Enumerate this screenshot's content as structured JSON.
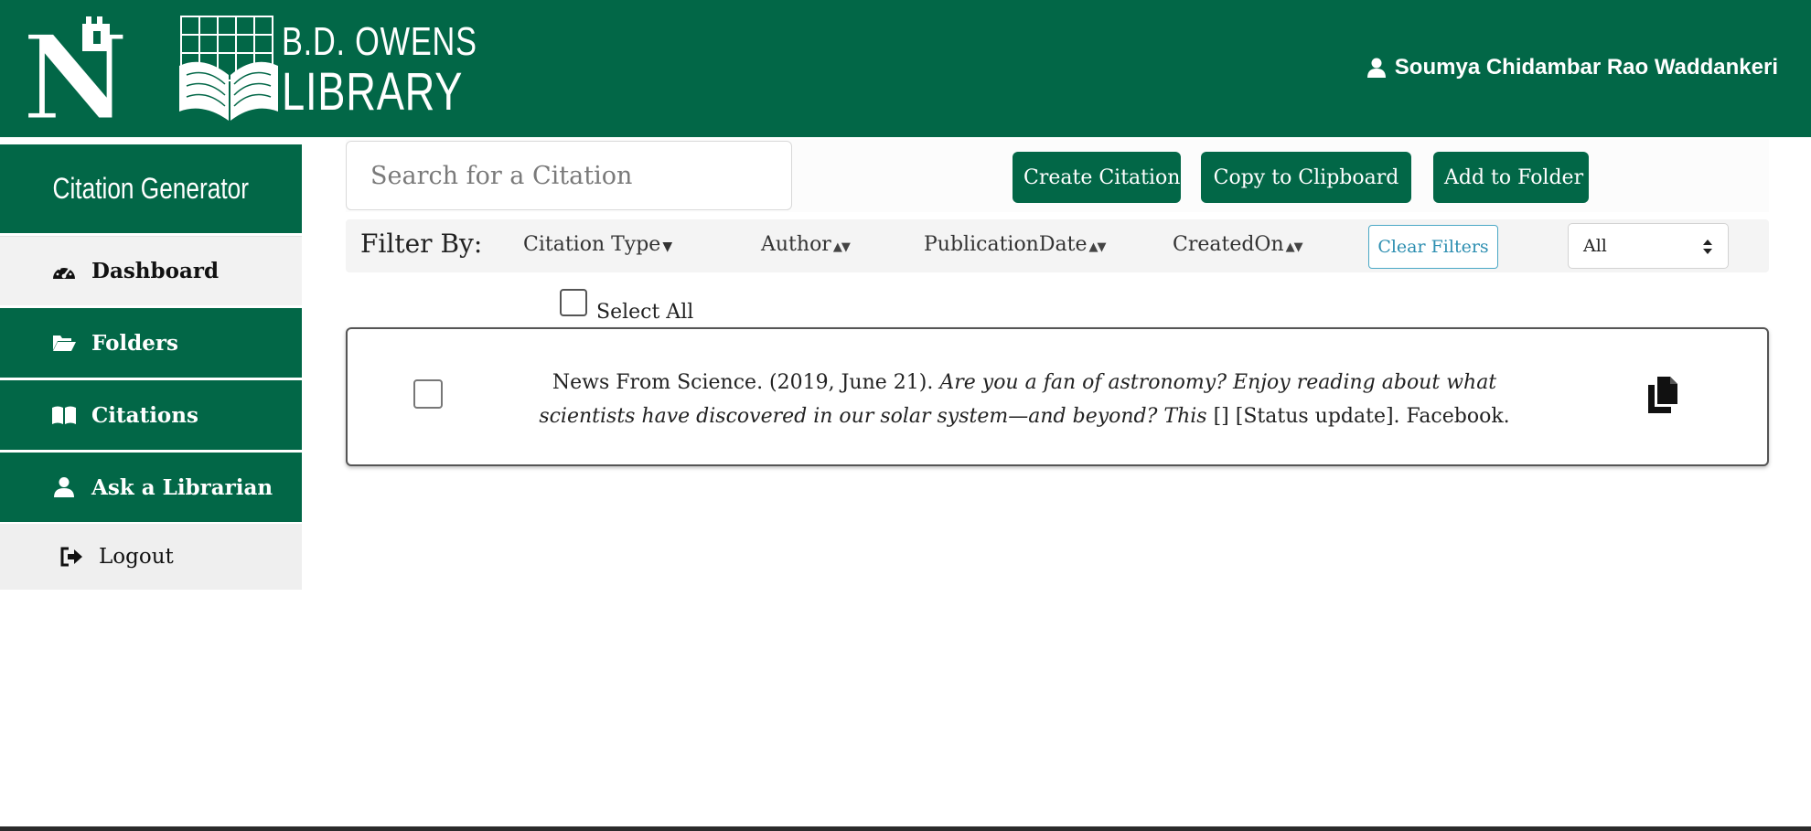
{
  "header": {
    "logo_initial": "N",
    "library_name_line1": "B.D. OWENS",
    "library_name_line2": "LIBRARY",
    "user_name": "Soumya Chidambar Rao Waddankeri",
    "brand_color": "#026747"
  },
  "sidebar": {
    "title": "Citation Generator",
    "items": [
      {
        "label": "Dashboard",
        "icon": "dashboard-icon"
      },
      {
        "label": "Folders",
        "icon": "folder-open-icon"
      },
      {
        "label": "Citations",
        "icon": "book-open-icon"
      },
      {
        "label": "Ask a Librarian",
        "icon": "user-icon"
      },
      {
        "label": "Logout",
        "icon": "sign-out-icon"
      }
    ]
  },
  "toolbar": {
    "search_placeholder": "Search for a Citation",
    "create_label": "Create Citation",
    "copy_label": "Copy to Clipboard",
    "add_folder_label": "Add to Folder"
  },
  "filters": {
    "label": "Filter By:",
    "citation_type": "Citation Type",
    "author": "Author",
    "publication_date": "PublicationDate",
    "created_on": "CreatedOn",
    "clear_label": "Clear Filters",
    "select_value": "All",
    "accent_color": "#2e8fb1"
  },
  "select_all_label": "Select All",
  "citations": [
    {
      "lead": "News From Science. (2019, June 21). ",
      "italic": "Are you a fan of astronomy? Enjoy reading about what scientists have discovered in our solar system—and beyond? This",
      "tail": " [] [Status update]. Facebook."
    }
  ]
}
